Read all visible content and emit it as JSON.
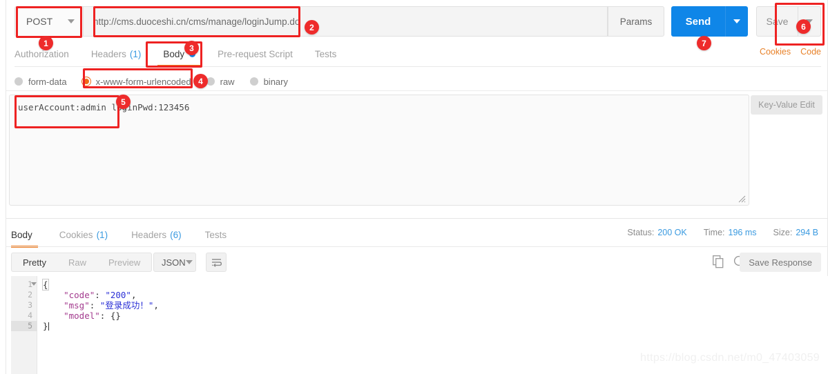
{
  "request": {
    "method": "POST",
    "url": "http://cms.duoceshi.cn/cms/manage/loginJump.do",
    "params_label": "Params",
    "send_label": "Send",
    "save_label": "Save",
    "cookies_link": "Cookies",
    "code_link": "Code",
    "tabs": [
      {
        "label": "Authorization",
        "count": "",
        "active": false
      },
      {
        "label": "Headers",
        "count": "(1)",
        "active": false
      },
      {
        "label": "Body",
        "count": "",
        "active": true
      },
      {
        "label": "Pre-request Script",
        "count": "",
        "active": false
      },
      {
        "label": "Tests",
        "count": "",
        "active": false
      }
    ],
    "body_types": [
      {
        "label": "form-data",
        "selected": false
      },
      {
        "label": "x-www-form-urlencoded",
        "selected": true
      },
      {
        "label": "raw",
        "selected": false
      },
      {
        "label": "binary",
        "selected": false
      }
    ],
    "body_text": "userAccount:admin\nloginPwd:123456",
    "key_value_edit_label": "Key-Value Edit"
  },
  "response": {
    "tabs": [
      {
        "label": "Body",
        "count": "",
        "active": true
      },
      {
        "label": "Cookies",
        "count": "(1)",
        "active": false
      },
      {
        "label": "Headers",
        "count": "(6)",
        "active": false
      },
      {
        "label": "Tests",
        "count": "",
        "active": false
      }
    ],
    "status_label": "Status:",
    "status_value": "200 OK",
    "time_label": "Time:",
    "time_value": "196 ms",
    "size_label": "Size:",
    "size_value": "294 B",
    "view_modes": [
      {
        "label": "Pretty",
        "active": true
      },
      {
        "label": "Raw",
        "active": false
      },
      {
        "label": "Preview",
        "active": false
      }
    ],
    "format": "JSON",
    "save_response_label": "Save Response",
    "code_lines": [
      {
        "num": "1",
        "fold": true,
        "highlight": false
      },
      {
        "num": "2",
        "fold": false,
        "highlight": false
      },
      {
        "num": "3",
        "fold": false,
        "highlight": false
      },
      {
        "num": "4",
        "fold": false,
        "highlight": false
      },
      {
        "num": "5",
        "fold": false,
        "highlight": true
      }
    ],
    "json": {
      "l1": "{",
      "l2_key": "\"code\"",
      "l2_val": "\"200\"",
      "l3_key": "\"msg\"",
      "l3_val": "\"登录成功！\"",
      "l4_key": "\"model\"",
      "l4_val": "{}",
      "l5": "}"
    }
  },
  "annotations": [
    {
      "id": "1",
      "label": "1"
    },
    {
      "id": "2",
      "label": "2"
    },
    {
      "id": "3",
      "label": "3"
    },
    {
      "id": "4",
      "label": "4"
    },
    {
      "id": "5",
      "label": "5"
    },
    {
      "id": "6",
      "label": "6"
    },
    {
      "id": "7",
      "label": "7"
    }
  ],
  "watermark": "https://blog.csdn.net/m0_47403059",
  "colors": {
    "accent_orange": "#ef7d22",
    "send_blue": "#0f86e8",
    "link_blue": "#3a9ae0",
    "annotation_red": "#ee2222"
  }
}
